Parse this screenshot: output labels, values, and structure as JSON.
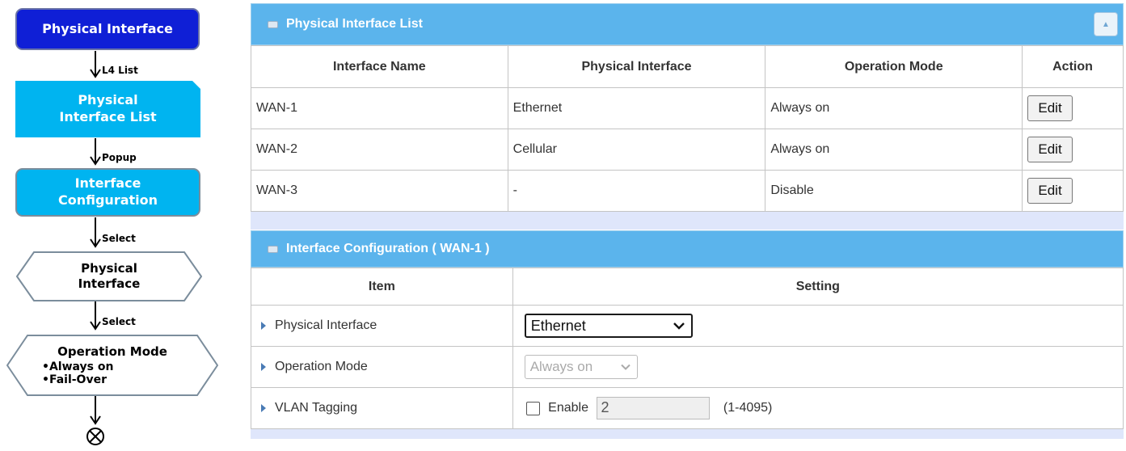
{
  "flow": {
    "top_node": "Physical Interface",
    "arrow1_label": "L4 List",
    "l4_node": [
      "Physical",
      "Interface List"
    ],
    "arrow2_label": "Popup",
    "popup_node": [
      "Interface",
      "Configuration"
    ],
    "arrow3_label": "Select",
    "select1_node": [
      "Physical",
      "Interface"
    ],
    "arrow4_label": "Select",
    "select2_title": "Operation Mode",
    "select2_options": [
      "•Always on",
      "•Fail-Over"
    ],
    "end_icon": "circle-cross-icon"
  },
  "list_panel": {
    "title": "Physical Interface List",
    "collapse_icon": "triangle-up-icon",
    "columns": [
      "Interface Name",
      "Physical Interface",
      "Operation Mode",
      "Action"
    ],
    "rows": [
      {
        "name": "WAN-1",
        "physical": "Ethernet",
        "mode": "Always on",
        "action": "Edit"
      },
      {
        "name": "WAN-2",
        "physical": "Cellular",
        "mode": "Always on",
        "action": "Edit"
      },
      {
        "name": "WAN-3",
        "physical": "-",
        "mode": "Disable",
        "action": "Edit"
      }
    ]
  },
  "config_panel": {
    "title": "Interface Configuration ( WAN-1 )",
    "columns": [
      "Item",
      "Setting"
    ],
    "physical_interface": {
      "label": "Physical Interface",
      "value": "Ethernet"
    },
    "operation_mode": {
      "label": "Operation Mode",
      "value": "Always on"
    },
    "vlan": {
      "label": "VLAN Tagging",
      "checkbox_label": "Enable",
      "value": "2",
      "range": "(1-4095)"
    }
  },
  "colors": {
    "header_bg": "#5bb4ec",
    "top_node": "#0f1fd6",
    "flow_node": "#00b4f0",
    "footer_bg": "#dfe6fb"
  }
}
